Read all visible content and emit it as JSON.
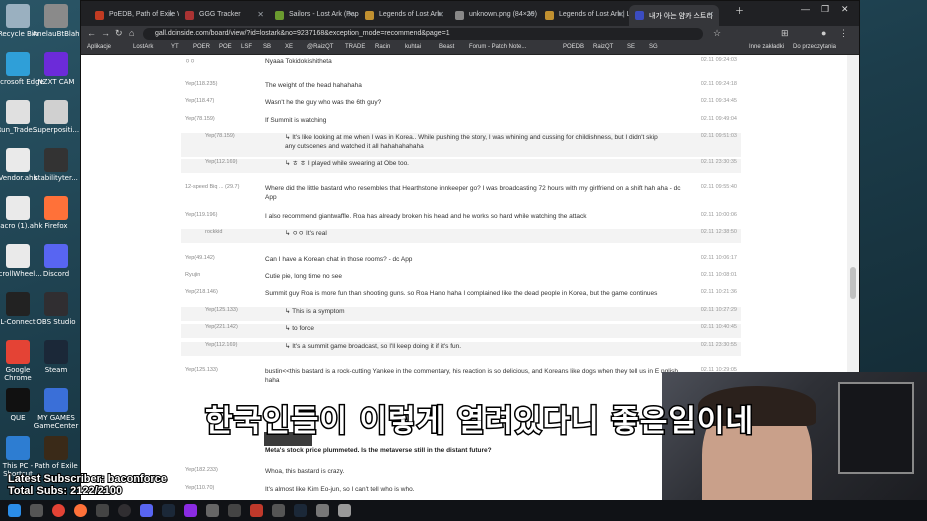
{
  "desktop": {
    "icons": [
      {
        "label": "Recycle Bin",
        "color": "#9ab0c0"
      },
      {
        "label": "AnelauBtBlah",
        "color": "#8a8a8a"
      },
      {
        "label": "Microsoft Edge",
        "color": "#2f9fd8"
      },
      {
        "label": "NZXT CAM",
        "color": "#6c2bd9"
      },
      {
        "label": "Run_Trade...",
        "color": "#e0e0e0"
      },
      {
        "label": "Superpositi...",
        "color": "#d0d0d0"
      },
      {
        "label": "Vendor.ahk",
        "color": "#eaeaea"
      },
      {
        "label": "stabilityter...",
        "color": "#333333"
      },
      {
        "label": "macro (1).ahk",
        "color": "#eaeaea"
      },
      {
        "label": "Firefox",
        "color": "#ff7139"
      },
      {
        "label": "ScrollWheel...",
        "color": "#eaeaea"
      },
      {
        "label": "Discord",
        "color": "#5865f2"
      },
      {
        "label": "L-Connect",
        "color": "#222222"
      },
      {
        "label": "OBS Studio",
        "color": "#302e31"
      },
      {
        "label": "Google Chrome",
        "color": "#e44335"
      },
      {
        "label": "Steam",
        "color": "#1b2838"
      },
      {
        "label": "QUE",
        "color": "#111111"
      },
      {
        "label": "MY GAMES GameCenter",
        "color": "#3a6fd8"
      },
      {
        "label": "This PC - Shortcut",
        "color": "#2d7dd2"
      },
      {
        "label": "Path of Exile",
        "color": "#3a2a18"
      }
    ]
  },
  "browser": {
    "tabs": [
      {
        "label": "PoEDB, Path of Exile Wi",
        "color": "#c23b22"
      },
      {
        "label": "GGG Tracker",
        "color": "#a33"
      },
      {
        "label": "Sailors - Lost Ark (Pap",
        "color": "#6a9b2f"
      },
      {
        "label": "Legends of Lost Ark",
        "color": "#c09030"
      },
      {
        "label": "unknown.png (84×29)",
        "color": "#888"
      },
      {
        "label": "Legends of Lost Ark | L",
        "color": "#c09030"
      },
      {
        "label": "내가 아는 얌카 스트리",
        "color": "#3b4cc0"
      }
    ],
    "url": "gall.dcinside.com/board/view/?id=lostark&no=9237168&exception_mode=recommend&page=1",
    "bookmarks": [
      "Aplikacje",
      "LostArk",
      "YT",
      "POER",
      "POE",
      "LSF",
      "SB",
      "XE",
      "@RaizQT",
      "TRADE",
      "Racin",
      "kuhtai",
      "Beast",
      "Forum - Patch Note...",
      "POEDB",
      "RaizQT",
      "SE",
      "SG",
      "Inne zakładki",
      "Do przeczytania"
    ]
  },
  "comments": [
    {
      "nick": "ㅇㅇ",
      "text": "Nyaaa Tokidokishitheta",
      "time": "02.11 09:24:03",
      "reply": false
    },
    {
      "nick": "Yep(118.235)",
      "text": "The weight of the head hahahaha",
      "time": "02.11 09:24:18",
      "reply": false
    },
    {
      "nick": "Yep(118.47)",
      "text": "Wasn't he the guy who was the 6th guy?",
      "time": "02.11 09:34:45",
      "reply": false
    },
    {
      "nick": "Yep(78.159)",
      "text": "If Summit is watching",
      "time": "02.11 09:49:04",
      "reply": false
    },
    {
      "nick": "Yep(78.159)",
      "text": "It's like looking at me when I was in Korea.. While pushing the story, I was whining and cussing for childishness, but I didn't skip any cutscenes and watched it all hahahahahaha",
      "time": "02.11 09:51:03",
      "reply": true
    },
    {
      "nick": "Yep(112.169)",
      "text": "ㅎ ㅎ I played while swearing at Obe too.",
      "time": "02.11 23:30:35",
      "reply": true
    },
    {
      "nick": "12-speed Biq ... (29.7)",
      "text": "Where did the little bastard who resembles that Hearthstone innkeeper go? I was broadcasting 72 hours with my girlfriend on a shift hah aha - dc App",
      "time": "02.11 09:55:40",
      "reply": false
    },
    {
      "nick": "Yep(119.196)",
      "text": "I also recommend giantwaffle. Roa has already broken his head and he works so hard while watching the attack",
      "time": "02.11 10:00:06",
      "reply": false
    },
    {
      "nick": "rockkid",
      "text": "ㅇㅇ It's real",
      "time": "02.11 12:38:50",
      "reply": true
    },
    {
      "nick": "Yep(49.142)",
      "text": "Can I have a Korean chat in those rooms? - dc App",
      "time": "02.11 10:06:17",
      "reply": false
    },
    {
      "nick": "Ryujin",
      "text": "Cutie pie, long time no see",
      "time": "02.11 10:08:01",
      "reply": false
    },
    {
      "nick": "Yep(218.146)",
      "text": "Summit guy Roa is more fun than shooting guns. so Roa Hano haha I complained like the dead people in Korea, but the game continues",
      "time": "02.11 10:21:36",
      "reply": false
    },
    {
      "nick": "Yep(125.133)",
      "text": "This is a symptom",
      "time": "02.11 10:27:29",
      "reply": true
    },
    {
      "nick": "Yep(221.142)",
      "text": "to force",
      "time": "02.11 10:40:45",
      "reply": true
    },
    {
      "nick": "Yep(112.169)",
      "text": "It's a summit game broadcast, so I'll keep doing it if it's fun.",
      "time": "02.11 23:30:55",
      "reply": true
    },
    {
      "nick": "Yep(125.133)",
      "text": "bustin<<this bastard is a rock-cutting Yankee in the commentary, his reaction is so delicious, and Koreans like dogs when they tell us in E nglish haha",
      "time": "02.11 10:29:05",
      "reply": false
    },
    {
      "nick": "",
      "text": "Meta's stock price plummeted. Is the metaverse still in the distant future?",
      "time": "",
      "reply": false
    },
    {
      "nick": "Yep(182.233)",
      "text": "Whoa, this bastard is crazy.",
      "time": "",
      "reply": false
    },
    {
      "nick": "Yep(110.70)",
      "text": "It's almost like Kim Eo-jun, so I can't tell who is who.",
      "time": "",
      "reply": false
    }
  ],
  "caption": "한국인들이 이렇게 열려있다니 좋은일이네",
  "overlay": {
    "line1": "Latest Subscriber: baconforce",
    "line2": "Total Subs: 2122/2100"
  }
}
